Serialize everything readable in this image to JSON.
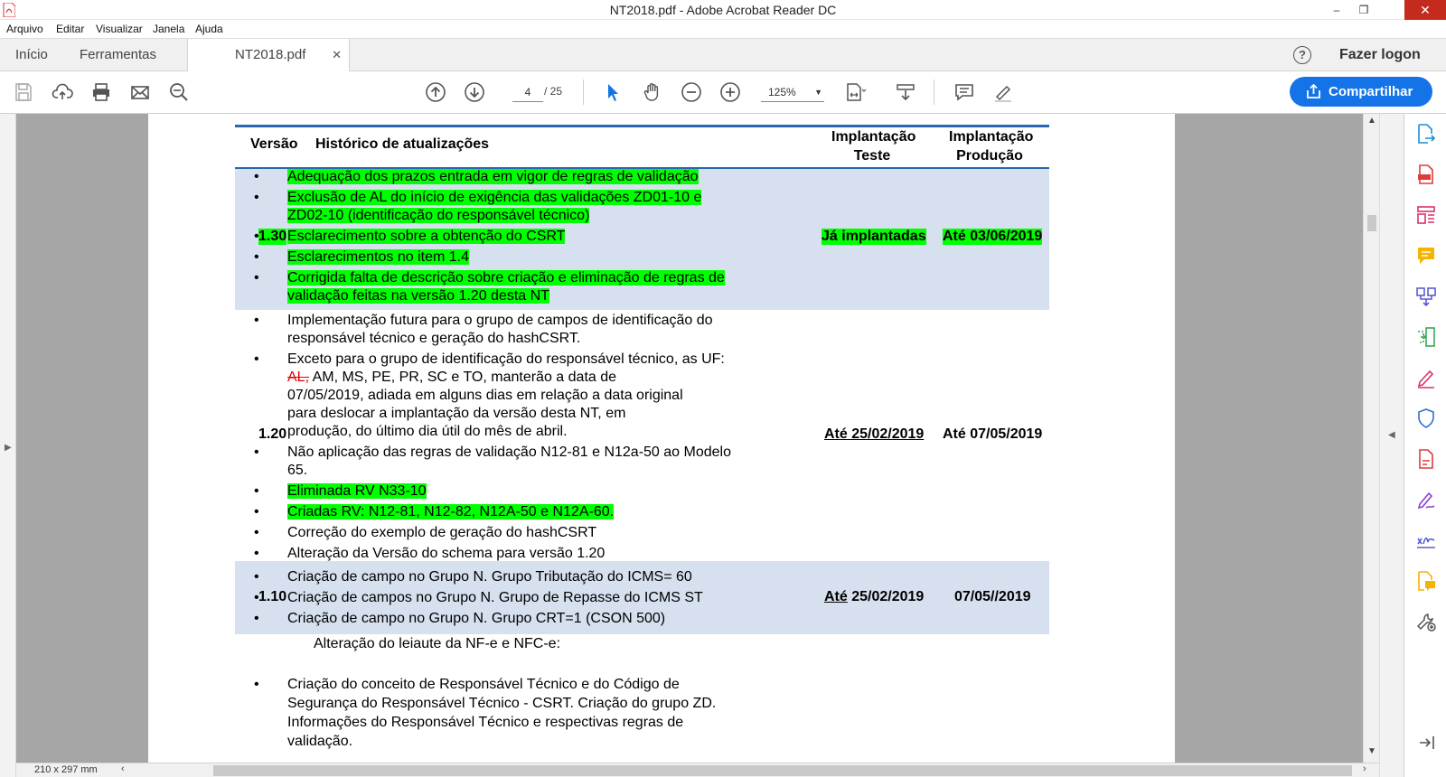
{
  "window": {
    "title": "NT2018.pdf - Adobe Acrobat Reader DC",
    "controls": [
      "–",
      "❐",
      "✕"
    ]
  },
  "menu": [
    "Arquivo",
    "Editar",
    "Visualizar",
    "Janela",
    "Ajuda"
  ],
  "tabs": {
    "home": "Início",
    "tools": "Ferramentas",
    "document": "NT2018.pdf",
    "close": "✕"
  },
  "header_right": {
    "login": "Fazer logon",
    "help": "?"
  },
  "toolbar": {
    "page_current": "4",
    "page_total": "/ 25",
    "zoom": "125%",
    "share": "Compartilhar"
  },
  "status": {
    "dims": "210 x 297 mm"
  },
  "table": {
    "headers": {
      "version": "Versão",
      "history": "Histórico de atualizações",
      "test_line1": "Implantação",
      "test_line2": "Teste",
      "prod_line1": "Implantação",
      "prod_line2": "Produção"
    },
    "rows": [
      {
        "version": "1.30",
        "items": [
          [
            "Adequação dos prazos entrada em vigor de regras de validação"
          ],
          [
            "Exclusão de AL do início de exigência das validações  ZD01-10 e",
            "ZD02-10 (identificação do responsável técnico)"
          ],
          [
            "Esclarecimento sobre a obtenção do CSRT"
          ],
          [
            "Esclarecimentos no item 1.4"
          ],
          [
            "Corrigida falta de descrição sobre criação e eliminação de regras de",
            "validação feitas na versão 1.20 desta NT"
          ]
        ],
        "test": "Já implantadas",
        "prod": "Até 03/06/2019"
      },
      {
        "version": "1.20",
        "item1": [
          "Implementação futura para o grupo de campos de identificação do",
          "responsável técnico e geração do hashCSRT."
        ],
        "item2_line1": "Exceto para o grupo de identificação do responsável técnico, as UF:",
        "item2_strike": "AL,",
        "item2_line2_rest": " AM, MS, PE, PR, SC e TO, manterão a data de",
        "item2_more": [
          "07/05/2019, adiada em alguns dias em relação a data original",
          "para deslocar a implantação da versão desta NT, em",
          "produção, do último dia útil do mês de abril."
        ],
        "item3": [
          "Não aplicação das regras de validação N12-81 e N12a-50 ao Modelo",
          "65."
        ],
        "item4": "Eliminada RV N33-10",
        "item5": "Criadas RV: N12-81, N12-82, N12A-50 e N12A-60.",
        "item6": "Correção do exemplo de geração do hashCSRT",
        "item7": "Alteração da Versão do schema para versão 1.20",
        "test": "Até 25/02/2019",
        "prod": "Até 07/05/2019"
      },
      {
        "version": "1.10",
        "items": [
          "Criação de campo no Grupo N. Grupo Tributação do ICMS= 60",
          "Criação de campos no Grupo N. Grupo de Repasse do ICMS ST",
          "Criação de campo no Grupo N. Grupo CRT=1 (CSON 500)"
        ],
        "test_prefix": "Até",
        "test_date": " 25/02/2019",
        "prod": "07/05//2019"
      }
    ],
    "after_text": "Alteração do leiaute da NF-e e NFC-e:",
    "after_bullet": [
      "Criação do conceito de Responsável Técnico e do Código de",
      "Segurança do Responsável Técnico - CSRT. Criação do grupo ZD.",
      "Informações do Responsável Técnico e respectivas regras de",
      "validação."
    ]
  },
  "bullet_glyph": "•",
  "colors": {
    "accent": "#1473e6",
    "highlight": "#00ff00",
    "row_shade": "#d6e0ef",
    "rule": "#2b66b0"
  }
}
